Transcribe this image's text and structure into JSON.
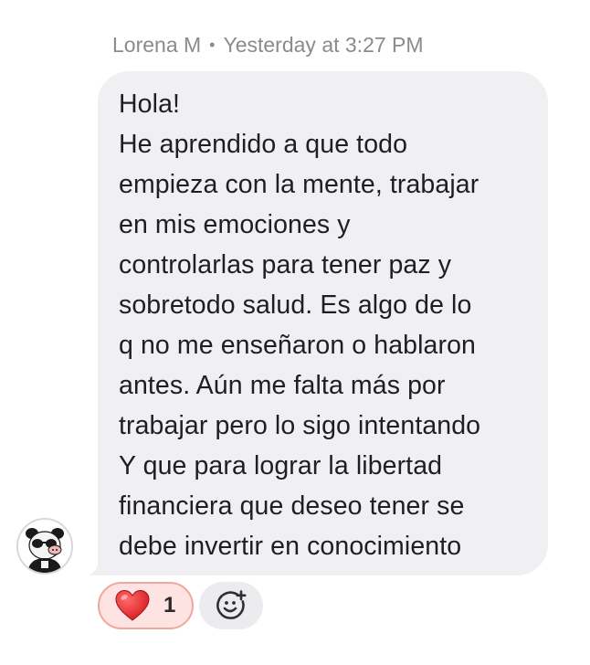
{
  "message": {
    "author": "Lorena M",
    "separator": "•",
    "timestamp": "Yesterday at 3:27 PM",
    "lines": [
      "Hola!",
      "He aprendido a que todo",
      "empieza con la mente, trabajar",
      "en mis emociones y",
      "controlarlas para tener paz y",
      "sobretodo salud. Es algo de lo",
      "q no me enseñaron o hablaron",
      "antes. Aún me falta más por",
      "trabajar pero lo sigo intentando",
      "Y que para lograr la libertad",
      "financiera que deseo tener se",
      "debe invertir en conocimiento"
    ],
    "bubble_color": "#f0f0f2",
    "avatar_icon": "panda-avatar-icon"
  },
  "reactions": [
    {
      "emoji": "❤️",
      "icon": "heart-icon",
      "count": "1",
      "color": "#e8282b"
    }
  ],
  "add_reaction": {
    "icon": "add-emoji-icon"
  }
}
